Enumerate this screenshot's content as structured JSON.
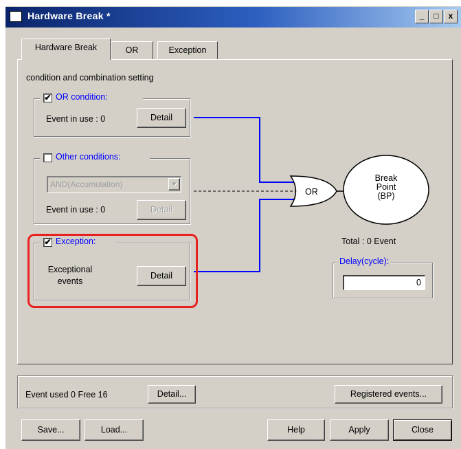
{
  "window": {
    "title": "Hardware Break *",
    "controls": [
      "_",
      "□",
      "x"
    ]
  },
  "tabs": [
    {
      "label": "Hardware Break",
      "active": true
    },
    {
      "label": "OR",
      "active": false
    },
    {
      "label": "Exception",
      "active": false
    }
  ],
  "section_title": "condition and combination setting",
  "or_condition": {
    "checked": true,
    "checkmark": "✔",
    "label": "OR condition:",
    "event_in_use": "Event in use : 0",
    "detail_label": "Detail"
  },
  "other_conditions": {
    "checked": false,
    "label": "Other conditions:",
    "dropdown_value": "AND(Accumulation)",
    "dropdown_arrow": "▾",
    "event_in_use": "Event in use : 0",
    "detail_label": "Detail"
  },
  "exception": {
    "checked": true,
    "checkmark": "✔",
    "label": "Exception:",
    "text_line1": "Exceptional",
    "text_line2": "events",
    "detail_label": "Detail"
  },
  "diagram": {
    "or_gate_label": "OR",
    "breakpoint_line1": "Break",
    "breakpoint_line2": "Point",
    "breakpoint_line3": "(BP)",
    "total_text": "Total : 0  Event",
    "delay_label": "Delay(cycle):",
    "delay_value": "0"
  },
  "status": {
    "event_used": "Event used   0  Free 16",
    "detail_button": "Detail...",
    "registered_button": "Registered events..."
  },
  "buttons": {
    "save": "Save...",
    "load": "Load...",
    "help": "Help",
    "apply": "Apply",
    "close": "Close"
  },
  "colors": {
    "title_gradient_start": "#0a246a",
    "title_gradient_end": "#a6caf0",
    "link_blue": "#0000ff",
    "highlight_red": "#e82020",
    "window_face": "#d4d0c8"
  }
}
